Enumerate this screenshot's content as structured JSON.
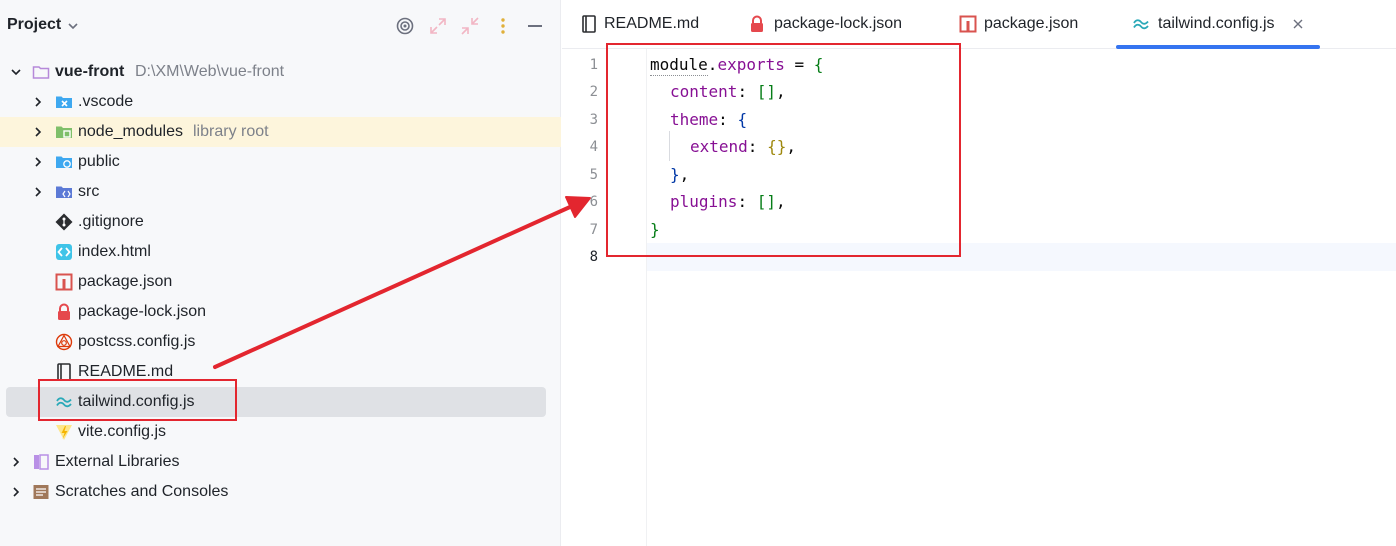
{
  "project_panel": {
    "title": "Project",
    "tree": [
      {
        "label": "vue-front",
        "hint": "D:\\XM\\Web\\vue-front",
        "icon": "folder-icon"
      },
      {
        "label": ".vscode",
        "hint": "",
        "icon": "vscode-folder-icon"
      },
      {
        "label": "node_modules",
        "hint": "library root",
        "icon": "node-folder-icon"
      },
      {
        "label": "public",
        "hint": "",
        "icon": "web-folder-icon"
      },
      {
        "label": "src",
        "hint": "",
        "icon": "source-folder-icon"
      },
      {
        "label": ".gitignore",
        "hint": "",
        "icon": "git-icon"
      },
      {
        "label": "index.html",
        "hint": "",
        "icon": "html-icon"
      },
      {
        "label": "package.json",
        "hint": "",
        "icon": "npm-icon"
      },
      {
        "label": "package-lock.json",
        "hint": "",
        "icon": "lock-icon"
      },
      {
        "label": "postcss.config.js",
        "hint": "",
        "icon": "postcss-icon"
      },
      {
        "label": "README.md",
        "hint": "",
        "icon": "readme-icon"
      },
      {
        "label": "tailwind.config.js",
        "hint": "",
        "icon": "tailwind-icon"
      },
      {
        "label": "vite.config.js",
        "hint": "",
        "icon": "vite-icon"
      },
      {
        "label": "External Libraries",
        "hint": "",
        "icon": "libraries-icon"
      },
      {
        "label": "Scratches and Consoles",
        "hint": "",
        "icon": "scratches-icon"
      }
    ]
  },
  "editor": {
    "tabs": [
      {
        "label": "README.md",
        "icon": "readme-icon"
      },
      {
        "label": "package-lock.json",
        "icon": "lock-icon"
      },
      {
        "label": "package.json",
        "icon": "npm-icon"
      },
      {
        "label": "tailwind.config.js",
        "icon": "tailwind-icon",
        "active": true
      }
    ],
    "line_numbers": [
      "1",
      "2",
      "3",
      "4",
      "5",
      "6",
      "7",
      "8"
    ],
    "code": {
      "l1": {
        "a": "module",
        "b": ".",
        "c": "exports",
        "d": " = ",
        "e": "{"
      },
      "l2": {
        "a": "content",
        "b": ": ",
        "c": "[]",
        "d": ","
      },
      "l3": {
        "a": "theme",
        "b": ": ",
        "c": "{"
      },
      "l4": {
        "a": "extend",
        "b": ": ",
        "c": "{}",
        "d": ","
      },
      "l5": {
        "a": "}",
        "b": ","
      },
      "l6": {
        "a": "plugins",
        "b": ": ",
        "c": "[]",
        "d": ","
      },
      "l7": {
        "a": "}"
      }
    }
  },
  "colors": {
    "accent": "#3574f0",
    "annotation_red": "#e3262f",
    "row_highlight": "#fdf5dc",
    "row_selected": "#dfe1e5"
  }
}
